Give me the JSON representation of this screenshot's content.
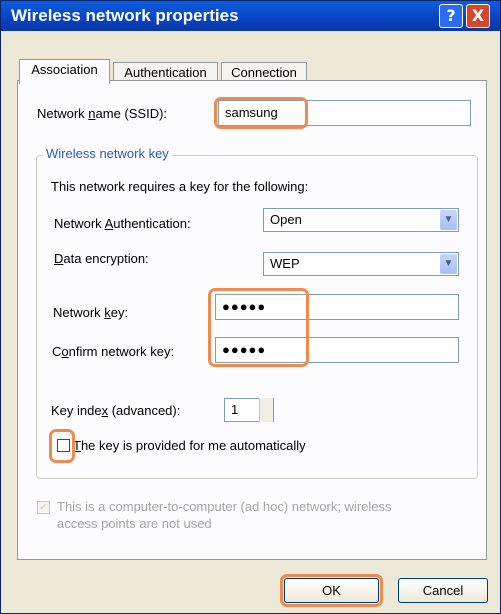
{
  "window": {
    "title": "Wireless network properties"
  },
  "title_buttons": {
    "help": "?",
    "close": "X"
  },
  "tabs": [
    {
      "label": "Association",
      "active": true
    },
    {
      "label": "Authentication",
      "active": false
    },
    {
      "label": "Connection",
      "active": false
    }
  ],
  "ssid": {
    "label_pre": "Network ",
    "label_ul": "n",
    "label_post": "ame (SSID):",
    "value": "samsung"
  },
  "wireless_key_group": {
    "label": "Wireless network key"
  },
  "requires_text": "This network requires a key for the following:",
  "network_auth": {
    "label_pre": "Network ",
    "label_ul": "A",
    "label_post": "uthentication:",
    "value": "Open"
  },
  "data_encryption": {
    "label_pre": "",
    "label_ul": "D",
    "label_post": "ata encryption:",
    "value": "WEP"
  },
  "network_key": {
    "label_pre": "Network ",
    "label_ul": "k",
    "label_post": "ey:",
    "value": "●●●●●"
  },
  "confirm_key": {
    "label_pre": "C",
    "label_ul": "o",
    "label_post": "nfirm network key:",
    "value": "●●●●●"
  },
  "key_index": {
    "label_pre": "Key inde",
    "label_ul": "x",
    "label_post": " (advanced):",
    "value": "1"
  },
  "auto_key": {
    "label_ul": "T",
    "label_post": "he key is provided for me automatically",
    "checked": false
  },
  "adhoc": {
    "line1": "This is a computer-to-computer (ad hoc) network; wireless",
    "line2": "access points are not used",
    "checked": true,
    "enabled": false
  },
  "buttons": {
    "ok": "OK",
    "cancel": "Cancel"
  },
  "colors": {
    "title_bar": "#0a4fd8",
    "highlight": "#ef8b4f",
    "group_label": "#2b5bb5",
    "dialog_bg": "#ece9d8"
  }
}
